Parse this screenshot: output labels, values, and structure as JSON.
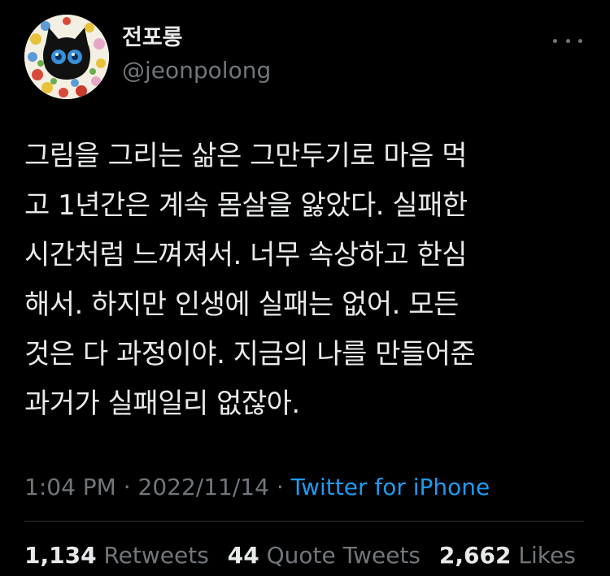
{
  "author": {
    "display_name": "전포롱",
    "handle": "@jeonpolong",
    "avatar_icon": "cat-avatar-icon"
  },
  "menu": {
    "icon": "more-horizontal-icon"
  },
  "tweet": {
    "lines": [
      "그림을 그리는 삶은 그만두기로 마음 먹",
      "고 1년간은 계속 몸살을 앓았다. 실패한",
      "시간처럼 느껴져서. 너무 속상하고 한심",
      "해서. 하지만 인생에 실패는 없어. 모든",
      "것은 다 과정이야. 지금의 나를 만들어준",
      "과거가 실패일리 없잖아."
    ]
  },
  "meta": {
    "time": "1:04 PM",
    "separator1": " · ",
    "date": "2022/11/14",
    "separator2": " · ",
    "source": "Twitter for iPhone"
  },
  "stats": {
    "retweets_count": "1,134",
    "retweets_label": "Retweets",
    "quotes_count": "44",
    "quotes_label": "Quote Tweets",
    "likes_count": "2,662",
    "likes_label": "Likes"
  },
  "colors": {
    "background": "#000000",
    "text": "#e7e9ea",
    "secondary": "#71767b",
    "link": "#1d9bf0",
    "divider": "#2f3336"
  }
}
